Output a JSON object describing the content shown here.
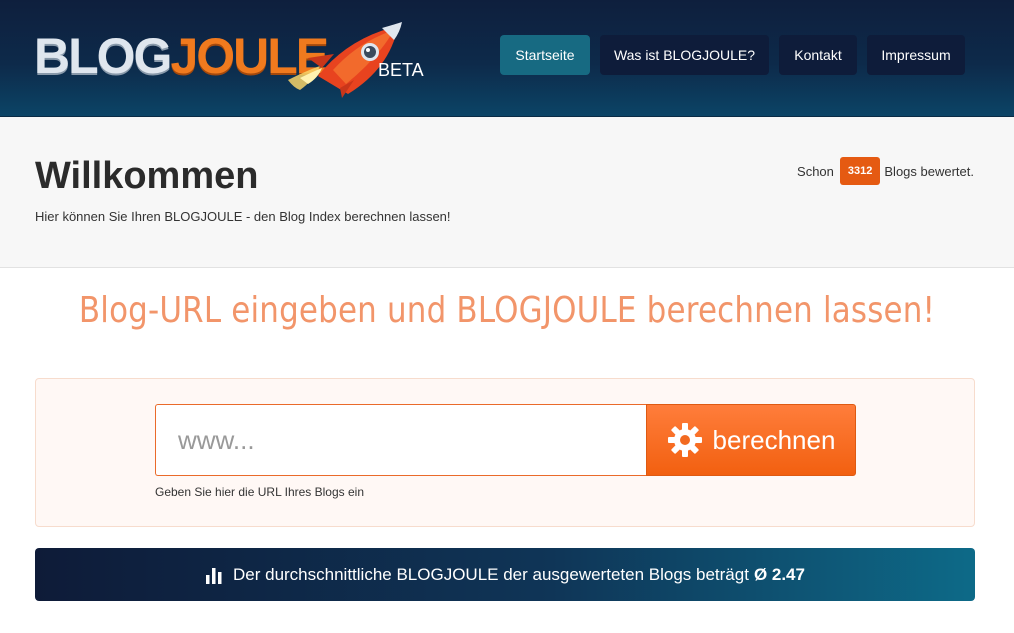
{
  "header": {
    "logo_part1": "BLOG",
    "logo_part2": "JOULE",
    "beta": "BETA",
    "nav": [
      {
        "label": "Startseite",
        "active": true
      },
      {
        "label": "Was ist BLOGJOULE?",
        "active": false
      },
      {
        "label": "Kontakt",
        "active": false
      },
      {
        "label": "Impressum",
        "active": false
      }
    ]
  },
  "welcome": {
    "title": "Willkommen",
    "subtitle": "Hier können Sie Ihren BLOGJOULE - den Blog Index berechnen lassen!",
    "count_prefix": "Schon",
    "count": "3312",
    "count_suffix": "Blogs bewertet."
  },
  "main": {
    "headline": "Blog-URL eingeben und BLOGJOULE berechnen lassen!",
    "url_placeholder": "www...",
    "button_label": "berechnen",
    "help_text": "Geben Sie hier die URL Ihres Blogs ein"
  },
  "average": {
    "text": "Der durchschnittliche BLOGJOULE der ausgewerteten Blogs beträgt",
    "value": "Ø 2.47"
  },
  "icons": {
    "rocket": "rocket-icon",
    "gear": "gear-icon",
    "chart": "bar-chart-icon"
  },
  "colors": {
    "accent": "#f26010",
    "header_dark": "#0e1f3d",
    "nav_active": "#176a82",
    "headline": "#f2956a"
  }
}
